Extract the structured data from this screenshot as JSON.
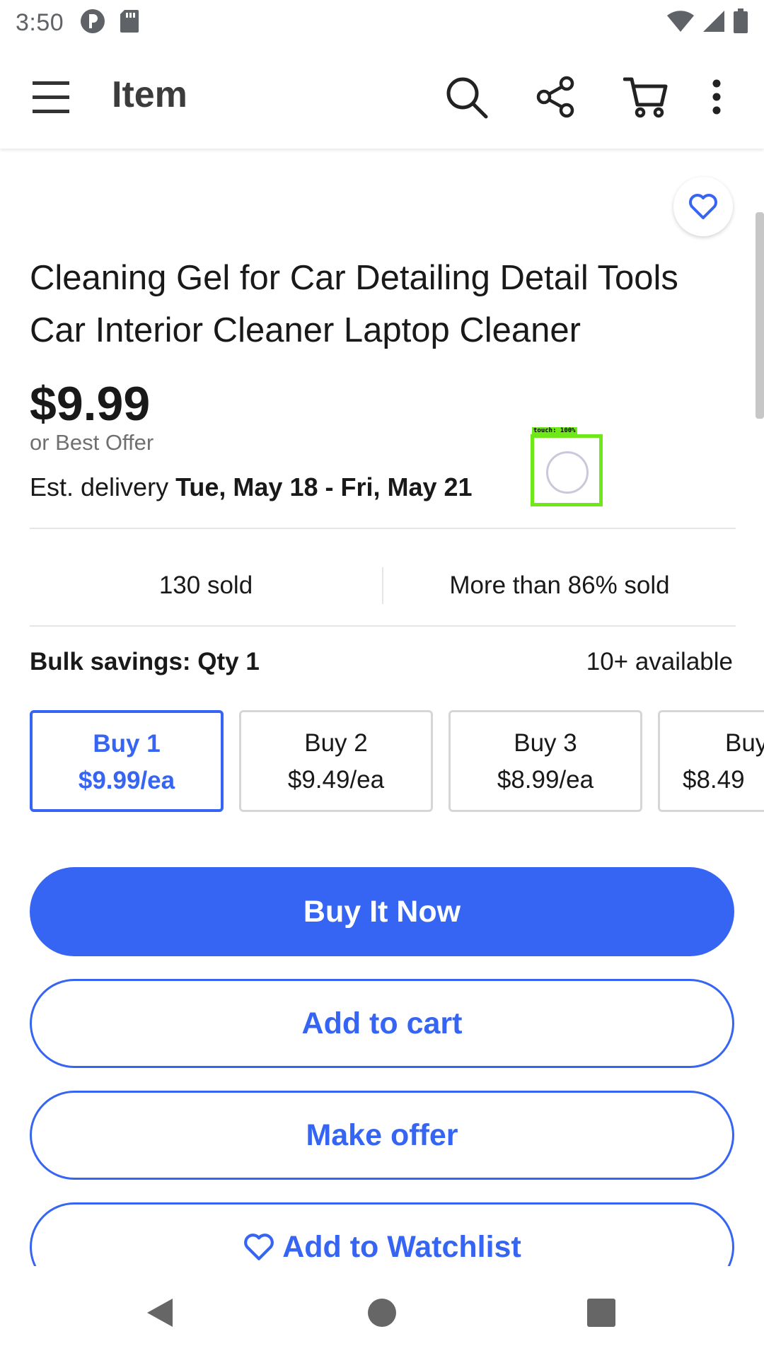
{
  "status_bar": {
    "time": "3:50"
  },
  "app_bar": {
    "title": "Item",
    "icons": [
      "menu-icon",
      "search-icon",
      "share-icon",
      "cart-icon",
      "more-vert-icon"
    ]
  },
  "item": {
    "title": "Cleaning Gel for Car Detailing Detail Tools Car Interior Cleaner Laptop Cleaner",
    "price": "$9.99",
    "best_offer": "or Best Offer",
    "delivery_prefix": "Est. delivery ",
    "delivery_dates": "Tue, May 18 - Fri, May 21",
    "sold_count": "130 sold",
    "sold_percent": "More than 86% sold"
  },
  "touch_overlay": {
    "label": "touch: 100%"
  },
  "bulk": {
    "label": "Bulk savings: Qty 1",
    "available": "10+ available",
    "options": [
      {
        "qty": "Buy 1",
        "price": "$9.99/ea",
        "selected": true
      },
      {
        "qty": "Buy 2",
        "price": "$9.49/ea",
        "selected": false
      },
      {
        "qty": "Buy 3",
        "price": "$8.99/ea",
        "selected": false
      },
      {
        "qty": "Buy",
        "price": "$8.49",
        "selected": false
      }
    ]
  },
  "actions": {
    "buy_now": "Buy It Now",
    "add_to_cart": "Add to cart",
    "make_offer": "Make offer",
    "add_to_watchlist": "Add to Watchlist"
  },
  "colors": {
    "accent": "#3665f3",
    "touch_box": "#6fe81a"
  }
}
